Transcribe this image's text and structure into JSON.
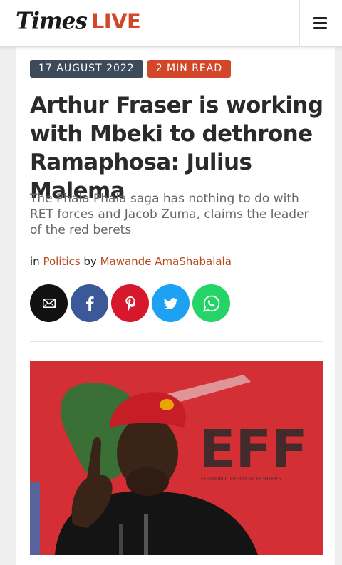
{
  "header": {
    "logo_times": "Times",
    "logo_live": "LIVE",
    "menu_icon": "hamburger-menu-icon"
  },
  "article": {
    "date": "17 AUGUST 2022",
    "read_time": "2 MIN READ",
    "title": "Arthur Fraser is working with Mbeki to dethrone Ramaphosa: Julius Malema",
    "subtitle": "The Phala Phala saga has nothing to do with RET forces and Jacob Zuma, claims the leader of the red berets",
    "byline_in": "in",
    "category": "Politics",
    "byline_by": "by",
    "author": "Mawande AmaShabalala"
  },
  "share": [
    {
      "name": "email",
      "icon": "email-icon",
      "color": "#111111"
    },
    {
      "name": "facebook",
      "icon": "facebook-icon",
      "color": "#3b5998"
    },
    {
      "name": "pinterest",
      "icon": "pinterest-icon",
      "color": "#d6172c"
    },
    {
      "name": "twitter",
      "icon": "twitter-icon",
      "color": "#1da1f2"
    },
    {
      "name": "whatsapp",
      "icon": "whatsapp-icon",
      "color": "#25d366"
    }
  ],
  "hero": {
    "backdrop_text": "EFF",
    "backdrop_small": "ECONOMIC FREEDOM FIGHTERS"
  },
  "colors": {
    "accent": "#d2462a",
    "date_badge": "#3c4a5a",
    "link": "#b8491f"
  }
}
